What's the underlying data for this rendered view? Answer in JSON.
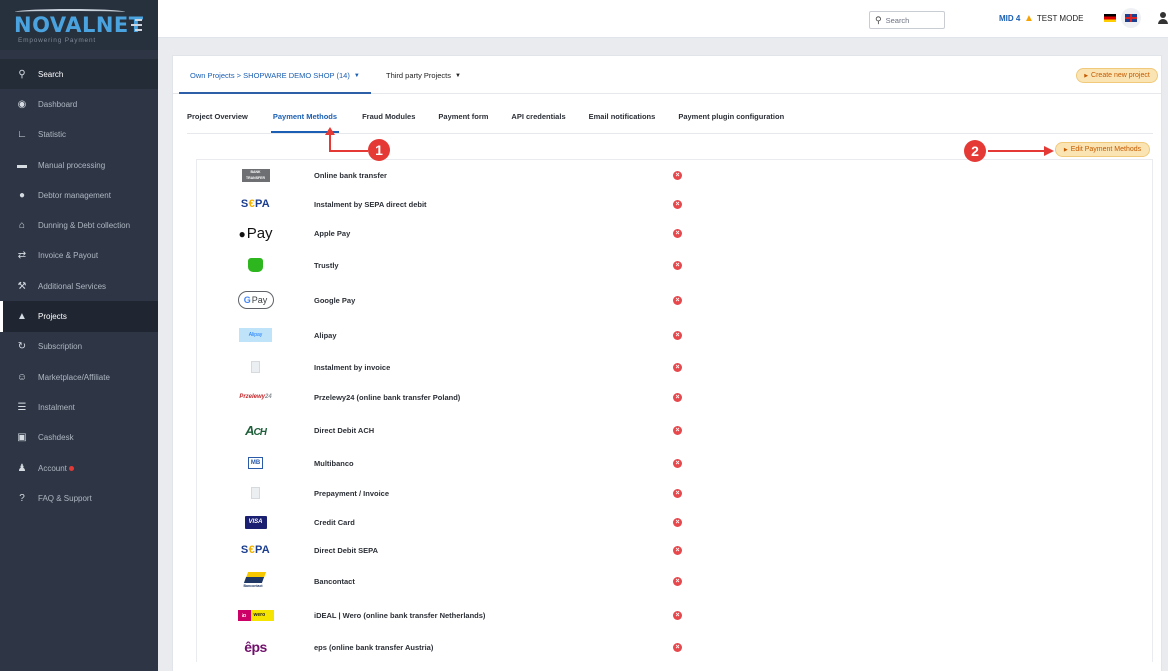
{
  "brand": {
    "name": "NOVALNET",
    "tagline": "Empowering Payment"
  },
  "sidebar": {
    "search_label": "Search",
    "items": [
      {
        "label": "Dashboard",
        "icon": "dashboard-icon"
      },
      {
        "label": "Statistic",
        "icon": "chart-icon"
      },
      {
        "label": "Manual processing",
        "icon": "card-icon"
      },
      {
        "label": "Debtor management",
        "icon": "users-icon"
      },
      {
        "label": "Dunning & Debt collection",
        "icon": "bank-icon"
      },
      {
        "label": "Invoice & Payout",
        "icon": "exchange-icon"
      },
      {
        "label": "Additional Services",
        "icon": "wrench-icon"
      },
      {
        "label": "Projects",
        "icon": "sitemap-icon",
        "active": true
      },
      {
        "label": "Subscription",
        "icon": "refresh-icon"
      },
      {
        "label": "Marketplace/Affiliate",
        "icon": "group-icon"
      },
      {
        "label": "Instalment",
        "icon": "coins-icon"
      },
      {
        "label": "Cashdesk",
        "icon": "cash-icon"
      },
      {
        "label": "Account",
        "icon": "user-icon"
      },
      {
        "label": "FAQ & Support",
        "icon": "question-icon"
      }
    ]
  },
  "topbar": {
    "search_placeholder": "Search",
    "mid": "MID 4",
    "mode": "TEST MODE"
  },
  "projects": {
    "own_projects": "Own Projects > SHOPWARE DEMO SHOP (14)",
    "third_party": "Third party Projects",
    "create_button": "Create new project"
  },
  "tabs": [
    "Project Overview",
    "Payment Methods",
    "Fraud Modules",
    "Payment form",
    "API credentials",
    "Email notifications",
    "Payment plugin configuration"
  ],
  "active_tab": "Payment Methods",
  "edit_button": "Edit Payment Methods",
  "annotations": {
    "badge_1": "1",
    "badge_2": "2"
  },
  "payment_methods": [
    {
      "name": "Online bank transfer",
      "logo": "bank-transfer-logo",
      "logo_text": "BANK TRANSFER",
      "status": "inactive"
    },
    {
      "name": "Instalment by SEPA direct debit",
      "logo": "sepa-logo",
      "status": "inactive"
    },
    {
      "name": "Apple Pay",
      "logo": "apple-pay-logo",
      "status": "inactive"
    },
    {
      "name": "Trustly",
      "logo": "trustly-logo",
      "status": "inactive"
    },
    {
      "name": "Google Pay",
      "logo": "google-pay-logo",
      "status": "inactive"
    },
    {
      "name": "Alipay",
      "logo": "alipay-logo",
      "logo_text": "Alipay",
      "status": "inactive"
    },
    {
      "name": "Instalment by invoice",
      "logo": "document-logo",
      "status": "inactive"
    },
    {
      "name": "Przelewy24 (online bank transfer Poland)",
      "logo": "przelewy24-logo",
      "status": "inactive"
    },
    {
      "name": "Direct Debit ACH",
      "logo": "ach-logo",
      "status": "inactive"
    },
    {
      "name": "Multibanco",
      "logo": "multibanco-logo",
      "status": "inactive"
    },
    {
      "name": "Prepayment / Invoice",
      "logo": "document-logo",
      "status": "inactive"
    },
    {
      "name": "Credit Card",
      "logo": "visa-logo",
      "logo_text": "VISA",
      "status": "inactive"
    },
    {
      "name": "Direct Debit SEPA",
      "logo": "sepa-logo",
      "status": "inactive"
    },
    {
      "name": "Bancontact",
      "logo": "bancontact-logo",
      "logo_text": "Bancontact",
      "status": "inactive"
    },
    {
      "name": "iDEAL | Wero (online bank transfer Netherlands)",
      "logo": "ideal-wero-logo",
      "logo_text": "wero",
      "status": "inactive"
    },
    {
      "name": "eps (online bank transfer Austria)",
      "logo": "eps-logo",
      "status": "inactive"
    }
  ],
  "colors": {
    "accent": "#1a5fb4",
    "sidebar": "#2e3645",
    "danger": "#e8474c",
    "button_bg": "#fbe4b3",
    "button_text": "#c25a00"
  }
}
